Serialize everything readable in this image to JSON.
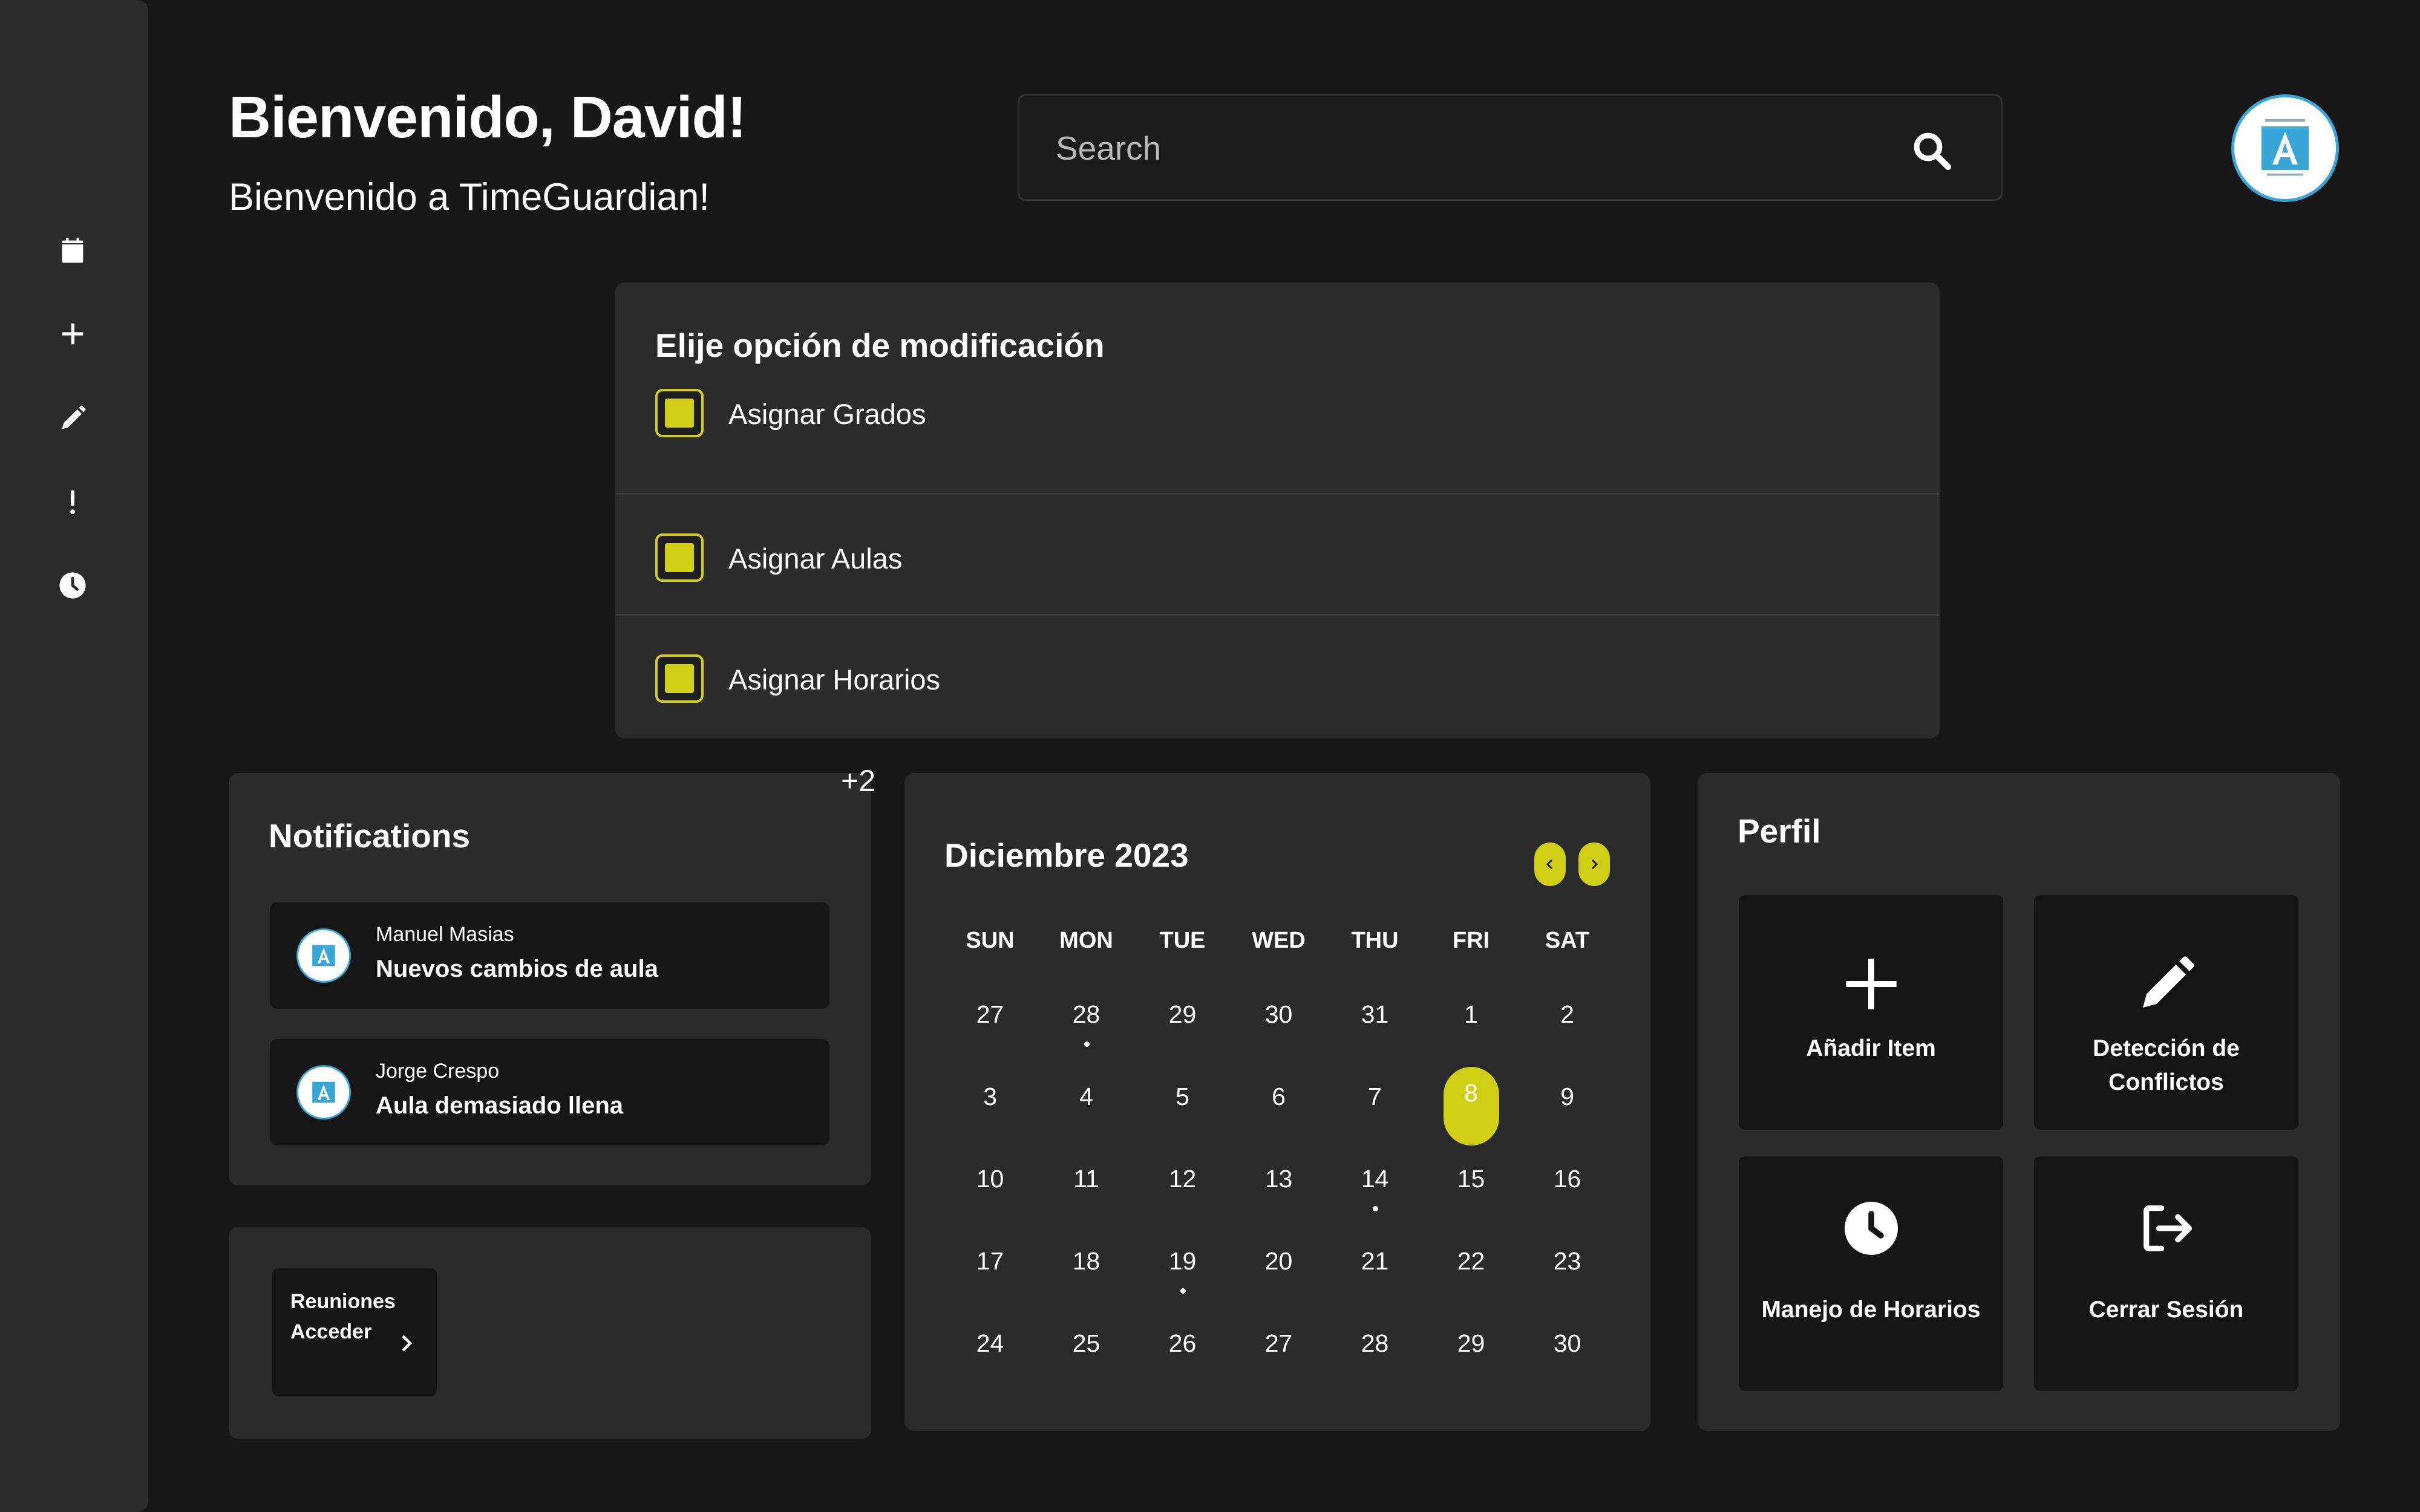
{
  "header": {
    "title": "Bienvenido, David!",
    "subtitle": "Bienvenido a TimeGuardian!"
  },
  "search": {
    "placeholder": "Search",
    "value": "",
    "icon": "search-icon"
  },
  "sidebar": {
    "items": [
      {
        "icon": "calendar-icon"
      },
      {
        "icon": "plus-icon"
      },
      {
        "icon": "pencil-icon"
      },
      {
        "icon": "exclamation-icon"
      },
      {
        "icon": "clock-icon"
      }
    ]
  },
  "modification": {
    "title": "Elije opción de modificación",
    "options": [
      {
        "label": "Asignar Grados",
        "checked": true
      },
      {
        "label": "Asignar Aulas",
        "checked": true
      },
      {
        "label": "Asignar Horarios",
        "checked": true
      }
    ]
  },
  "notifications": {
    "title": "Notifications",
    "extra_count": "+2",
    "items": [
      {
        "name": "Manuel Masias",
        "message": "Nuevos cambios de aula"
      },
      {
        "name": "Jorge Crespo",
        "message": "Aula demasiado llena"
      }
    ]
  },
  "meetings": {
    "line1": "Reuniones",
    "line2": "Acceder"
  },
  "calendar": {
    "title": "Diciembre 2023",
    "weekdays": [
      "SUN",
      "MON",
      "TUE",
      "WED",
      "THU",
      "FRI",
      "SAT"
    ],
    "days": [
      "27",
      "28",
      "29",
      "30",
      "31",
      "1",
      "2",
      "3",
      "4",
      "5",
      "6",
      "7",
      "8",
      "9",
      "10",
      "11",
      "12",
      "13",
      "14",
      "15",
      "16",
      "17",
      "18",
      "19",
      "20",
      "21",
      "22",
      "23",
      "24",
      "25",
      "26",
      "27",
      "28",
      "29",
      "30"
    ],
    "selected_index": 12,
    "event_dot_indices": [
      1,
      18,
      23
    ],
    "accent": "#d1cf15"
  },
  "profile": {
    "title": "Perfil",
    "tiles": [
      {
        "label": "Añadir Item",
        "icon": "plus-icon"
      },
      {
        "label": "Detección de Conflictos",
        "icon": "pencil-icon"
      },
      {
        "label": "Manejo de Horarios",
        "icon": "clock-icon"
      },
      {
        "label": "Cerrar Sesión",
        "icon": "logout-icon"
      }
    ]
  },
  "colors": {
    "background": "#171717",
    "card": "#2b2b2b",
    "tile": "#151515",
    "accent": "#d1cf15",
    "logo_blue": "#39a6d8"
  }
}
